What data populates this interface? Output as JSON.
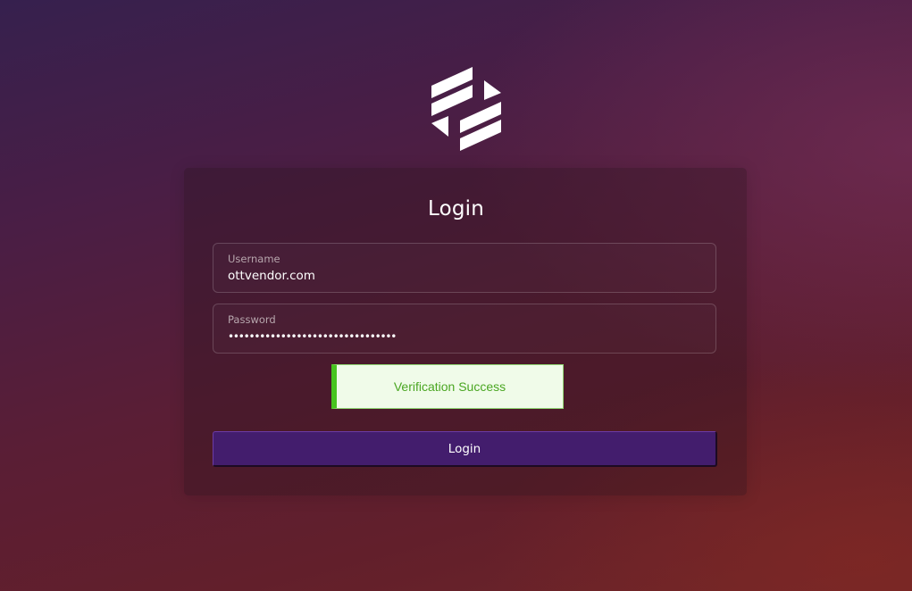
{
  "brand": {
    "logo_icon": "brand-logo-icon",
    "logo_color": "#ffffff"
  },
  "login_form": {
    "title": "Login",
    "username": {
      "label": "Username",
      "value": "ottvendor.com"
    },
    "password": {
      "label": "Password",
      "value": "••••••••••••••••••••••••••••••••"
    },
    "verification": {
      "text": "Verification Success",
      "status_color": "#47c41f"
    },
    "submit_label": "Login",
    "button_color": "#431d6d"
  }
}
